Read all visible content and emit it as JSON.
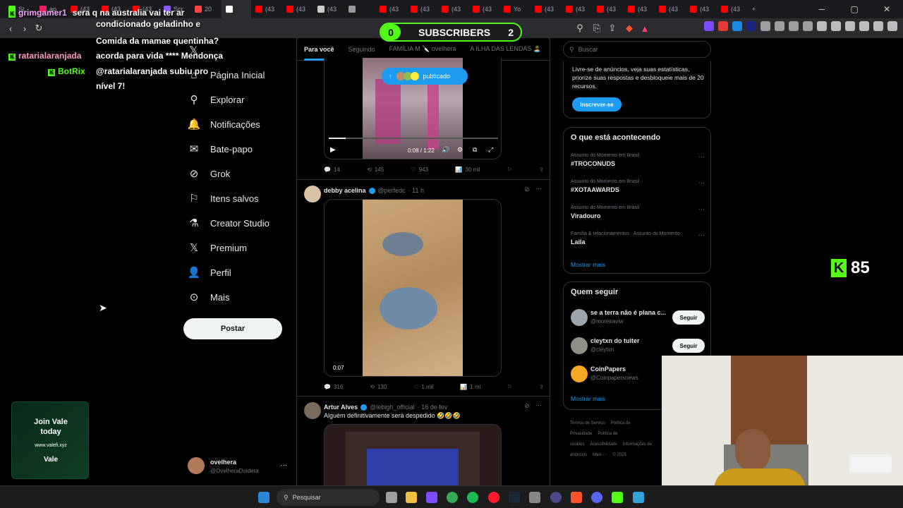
{
  "browser": {
    "tabs": [
      {
        "label": "St",
        "color": "#53fc18"
      },
      {
        "label": "ao",
        "color": "#e91e63"
      },
      {
        "label": "(43",
        "color": "#ff0000"
      },
      {
        "label": "(43",
        "color": "#ff0000"
      },
      {
        "label": "(43",
        "color": "#ff0000"
      },
      {
        "label": "Scr",
        "color": "#8a5cf6"
      },
      {
        "label": "20",
        "color": "#ff4444"
      },
      {
        "label": "",
        "color": "#ffffff",
        "active": true
      },
      {
        "label": "(43",
        "color": "#ff0000"
      },
      {
        "label": "(43",
        "color": "#ff0000"
      },
      {
        "label": "(43",
        "color": "#cccccc"
      },
      {
        "label": "",
        "color": "#999999"
      },
      {
        "label": "(43",
        "color": "#ff0000"
      },
      {
        "label": "(43",
        "color": "#ff0000"
      },
      {
        "label": "(43",
        "color": "#ff0000"
      },
      {
        "label": "(43",
        "color": "#ff0000"
      },
      {
        "label": "Yo",
        "color": "#ff0000"
      },
      {
        "label": "(43",
        "color": "#ff0000"
      },
      {
        "label": "(43",
        "color": "#ff0000"
      },
      {
        "label": "(43",
        "color": "#ff0000"
      },
      {
        "label": "(43",
        "color": "#ff0000"
      },
      {
        "label": "(43",
        "color": "#ff0000"
      },
      {
        "label": "(43",
        "color": "#ff0000"
      },
      {
        "label": "(43",
        "color": "#ff0000"
      }
    ],
    "new_tab": "+",
    "minimize": "─",
    "maximize": "▢",
    "close": "✕"
  },
  "chat": {
    "lines": [
      {
        "user": "grimgamer1",
        "user_color": "#f3a6ff",
        "text": "sera q na australia vai ter ar"
      },
      {
        "user": "",
        "user_color": "",
        "text": "condicionado geladinho e"
      },
      {
        "user": "",
        "user_color": "",
        "text": "Comida da mamae quentinha?"
      },
      {
        "user": "",
        "user_color": "",
        "text": "acorda para vida **** Mendonça"
      },
      {
        "user": "ratarialaranjada",
        "user_color": "#ff9dbb",
        "text": ""
      },
      {
        "user": "BotRix",
        "user_color": "#53fc18",
        "text": ""
      },
      {
        "user": "",
        "user_color": "",
        "text": "@ratarialaranjada subiu pro"
      },
      {
        "user": "",
        "user_color": "",
        "text": "nível 7!"
      }
    ]
  },
  "subscribers": {
    "left_count": "0",
    "label": "SUBSCRIBERS",
    "right_count": "2"
  },
  "viewer_count": "85",
  "promo": {
    "line1": "Join Vale",
    "line2": "today",
    "url": "www.valefi.xyz",
    "brand": "Vale"
  },
  "nav": {
    "items": [
      {
        "label": "Página Inicial",
        "icon": "home-icon",
        "glyph": "⌂"
      },
      {
        "label": "Explorar",
        "icon": "search-icon",
        "glyph": "⚲"
      },
      {
        "label": "Notificações",
        "icon": "bell-icon",
        "glyph": "🔔"
      },
      {
        "label": "Bate-papo",
        "icon": "mail-icon",
        "glyph": "✉"
      },
      {
        "label": "Grok",
        "icon": "grok-icon",
        "glyph": "⊘"
      },
      {
        "label": "Itens salvos",
        "icon": "bookmark-icon",
        "glyph": "⚐"
      },
      {
        "label": "Creator Studio",
        "icon": "flask-icon",
        "glyph": "⚗"
      },
      {
        "label": "Premium",
        "icon": "x-logo-icon",
        "glyph": "𝕏"
      },
      {
        "label": "Perfil",
        "icon": "person-icon",
        "glyph": "👤"
      },
      {
        "label": "Mais",
        "icon": "more-circle-icon",
        "glyph": "⊙"
      }
    ],
    "post_button": "Postar",
    "account_name": "ovelhera",
    "account_handle": "@OvelheraDoidera",
    "account_more": "···"
  },
  "feed": {
    "tabs": [
      "Para você",
      "Seguindo",
      "FAMÍLIA M 🔪 ovelhera",
      "A ILHA DAS LENDAS 🏝️"
    ],
    "published_pill": "publicado",
    "video1": {
      "time": "0:08 / 1:22",
      "progress": 0.1
    },
    "tweet1_actions": {
      "replies": "14",
      "reposts": "145",
      "likes": "943",
      "views": "30 mil"
    },
    "tweet2": {
      "name": "debby acelina",
      "handle": "@perfedc",
      "time": "· 11 h",
      "video_time": "0:07"
    },
    "tweet2_actions": {
      "replies": "316",
      "reposts": "130",
      "likes": "1 mil",
      "views": "1 mi"
    },
    "tweet3": {
      "name": "Artur Alves",
      "handle": "@lebigh_official",
      "time": "· 16 de fev",
      "text": "Alguém definitivamente será despedido 🤣🤣🤣"
    }
  },
  "right": {
    "search_placeholder": "Buscar",
    "premium": {
      "text": "Livre-se de anúncios, veja suas estatísticas, priorize suas respostas e desbloqueie mais de 20 recursos.",
      "button": "Inscrever-se"
    },
    "trends_title": "O que está acontecendo",
    "trends": [
      {
        "cat": "Assunto do Momento em Brasil",
        "name": "#TROCONUDS"
      },
      {
        "cat": "Assunto do Momento em Brasil",
        "name": "#XOTAAWARDS"
      },
      {
        "cat": "Assunto do Momento em Brasil",
        "name": "Viradouro"
      },
      {
        "cat": "Família & relacionamentos · Assunto do Momento",
        "name": "Laila"
      }
    ],
    "show_more": "Mostrar mais",
    "who_title": "Quem seguir",
    "who": [
      {
        "name": "se a terra não é plana c...",
        "handle": "@moreiraviw",
        "button": "Seguir"
      },
      {
        "name": "cleytxn do tuiter",
        "handle": "@cleytxn",
        "button": "Seguir"
      },
      {
        "name": "CoinPapers",
        "handle": "@Coinpapersnews",
        "button": ""
      }
    ],
    "who_more": "Mostrar mais",
    "footer": [
      "Termos de Serviço",
      "Política de Privacidade",
      "Política de cookies",
      "Acessibilidade",
      "Informações de anúncios",
      "Mais ···",
      "© 2025"
    ]
  },
  "taskbar": {
    "search": "Pesquisar"
  }
}
